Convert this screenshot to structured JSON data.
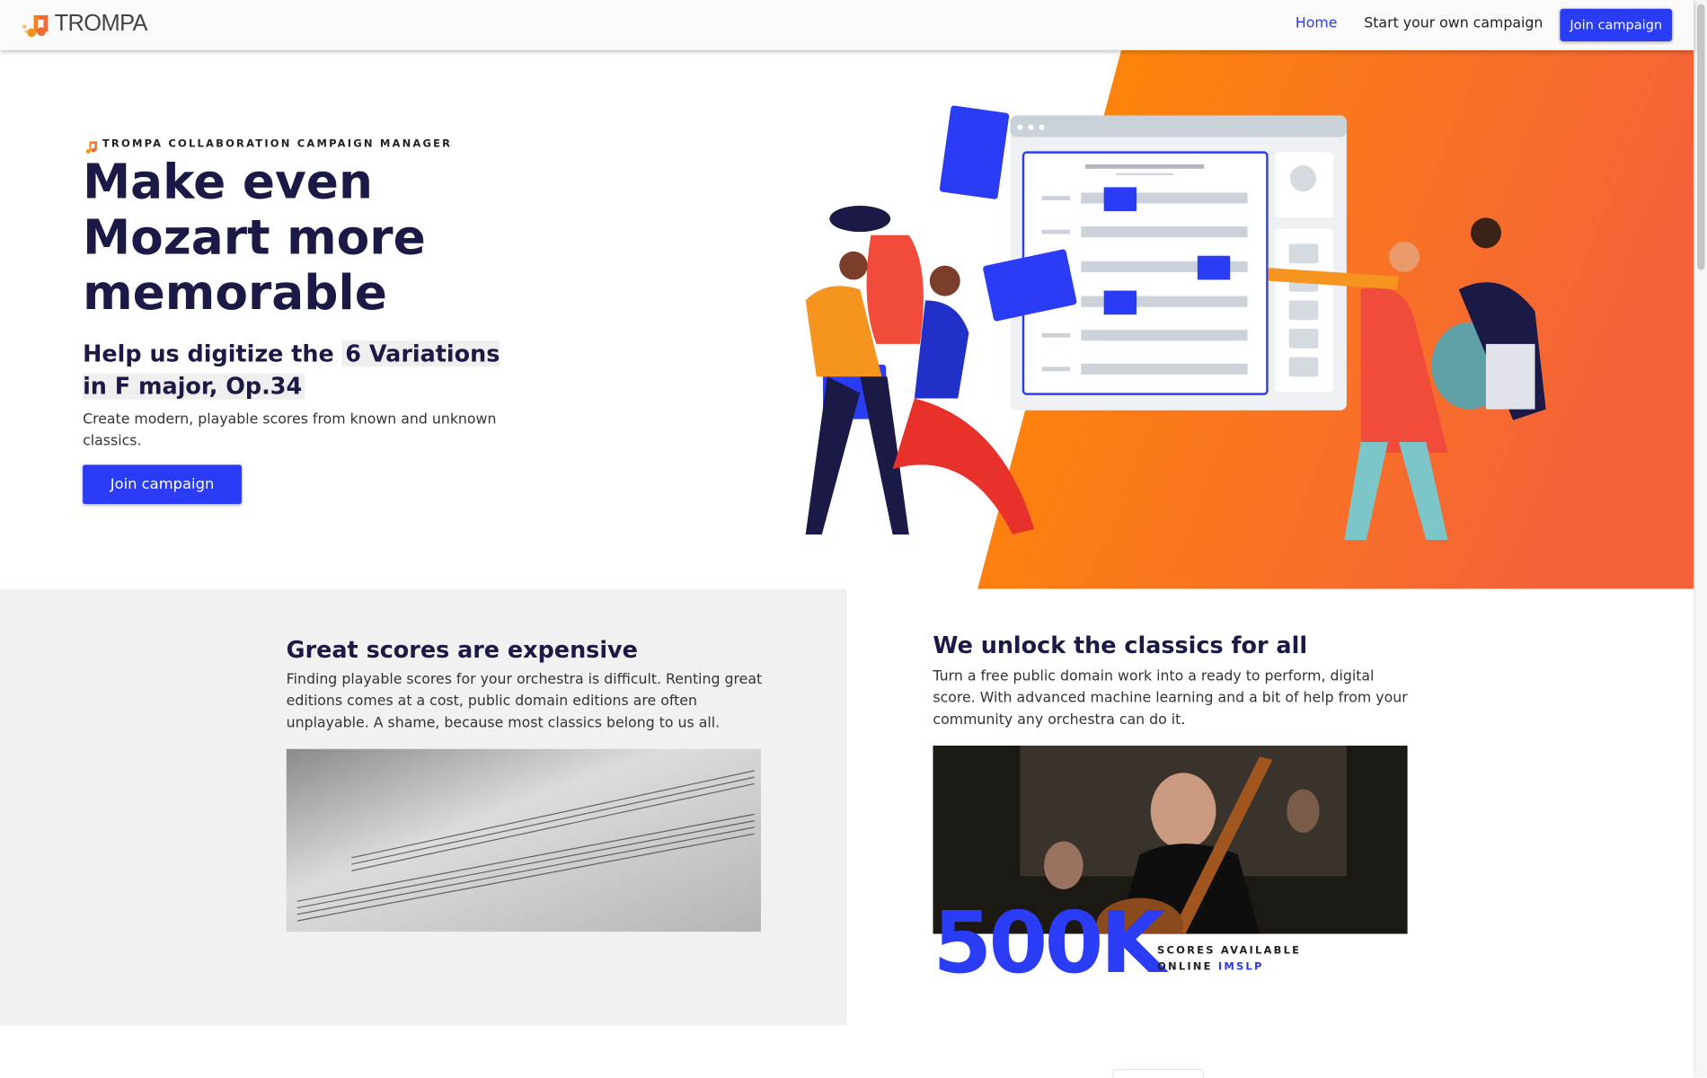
{
  "nav": {
    "brand": "TROMPA",
    "links": [
      {
        "label": "Home",
        "active": true
      },
      {
        "label": "Start your own campaign",
        "active": false
      }
    ],
    "cta_label": "Join campaign"
  },
  "hero": {
    "eyebrow": "TROMPA COLLABORATION CAMPAIGN MANAGER",
    "title": "Make even Mozart more memorable",
    "subtitle_prefix": "Help us digitize the",
    "work_title": "6 Variations in F major, Op.34",
    "description": "Create modern, playable scores from known and unknown classics.",
    "cta_label": "Join campaign"
  },
  "features": [
    {
      "title": "Great scores are expensive",
      "text": "Finding playable scores for your orchestra is difficult. Renting great editions comes at a cost, public domain editions are often unplayable. A shame, because most classics belong to us all.",
      "image": "sheet-music-photo"
    },
    {
      "title": "We unlock the classics for all",
      "text": "Turn a free public domain work into a ready to perform, digital score. With advanced machine learning and a bit of help from your community any orchestra can do it.",
      "image": "cellist-orchestra-photo"
    }
  ],
  "stat": {
    "value": "500K",
    "label_line1": "SCORES AVAILABLE",
    "label_line2": "ONLINE",
    "source_link": "IMSLP"
  },
  "colors": {
    "accent": "#2a3cf5",
    "heading": "#1b1a47",
    "orange": "#ff8a00",
    "orange_red": "#f4623a"
  }
}
